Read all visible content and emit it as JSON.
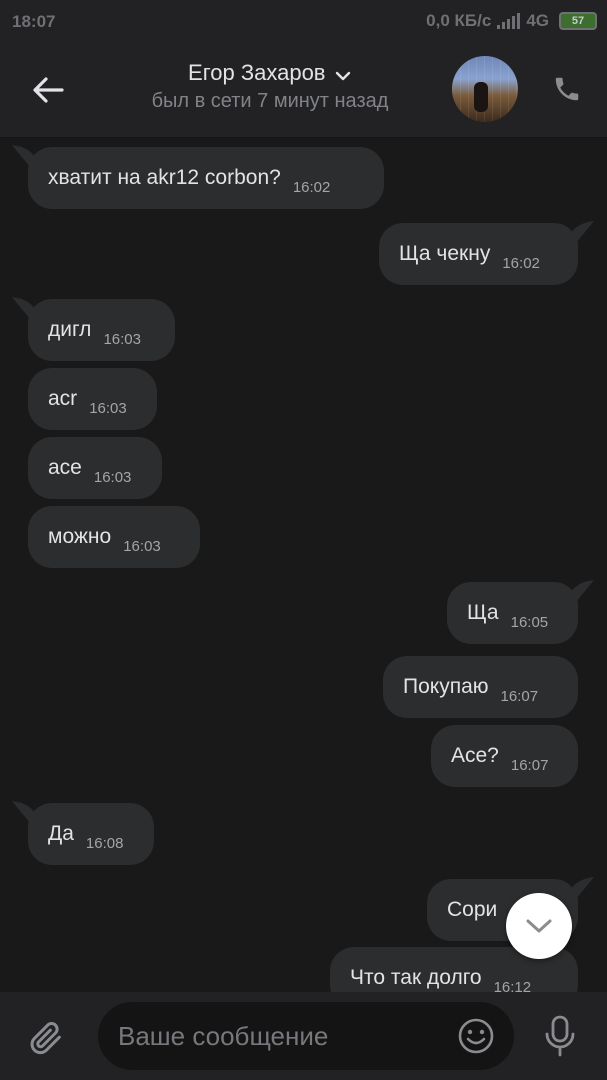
{
  "status_bar": {
    "time": "18:07",
    "speed": "0,0 КБ/с",
    "network": "4G",
    "battery": "57"
  },
  "header": {
    "contact_name": "Егор Захаров",
    "last_seen": "был в сети 7 минут назад"
  },
  "messages": [
    {
      "text": "хватит на akr12 corbon?",
      "time": "16:02",
      "side": "in"
    },
    {
      "text": "Ща чекну",
      "time": "16:02",
      "side": "out"
    },
    {
      "text": "дигл",
      "time": "16:03",
      "side": "in"
    },
    {
      "text": "acr",
      "time": "16:03",
      "side": "in"
    },
    {
      "text": "ace",
      "time": "16:03",
      "side": "in"
    },
    {
      "text": "можно",
      "time": "16:03",
      "side": "in"
    },
    {
      "text": "Ща",
      "time": "16:05",
      "side": "out"
    },
    {
      "text": "Покупаю",
      "time": "16:07",
      "side": "out"
    },
    {
      "text": "Ace?",
      "time": "16:07",
      "side": "out"
    },
    {
      "text": "Да",
      "time": "16:08",
      "side": "in"
    },
    {
      "text": "Сори",
      "time": "",
      "side": "out"
    },
    {
      "text": "Что так долго",
      "time": "16:12",
      "side": "out"
    }
  ],
  "composer": {
    "placeholder": "Ваше сообщение"
  },
  "colors": {
    "background": "#19191a",
    "bubble": "#2c2d2e",
    "header": "#222224",
    "text": "#e1e3e6",
    "muted": "#818387"
  },
  "icons": [
    "back-arrow-icon",
    "chevron-down-icon",
    "phone-icon",
    "scroll-down-icon",
    "paperclip-icon",
    "smile-icon",
    "microphone-icon"
  ]
}
